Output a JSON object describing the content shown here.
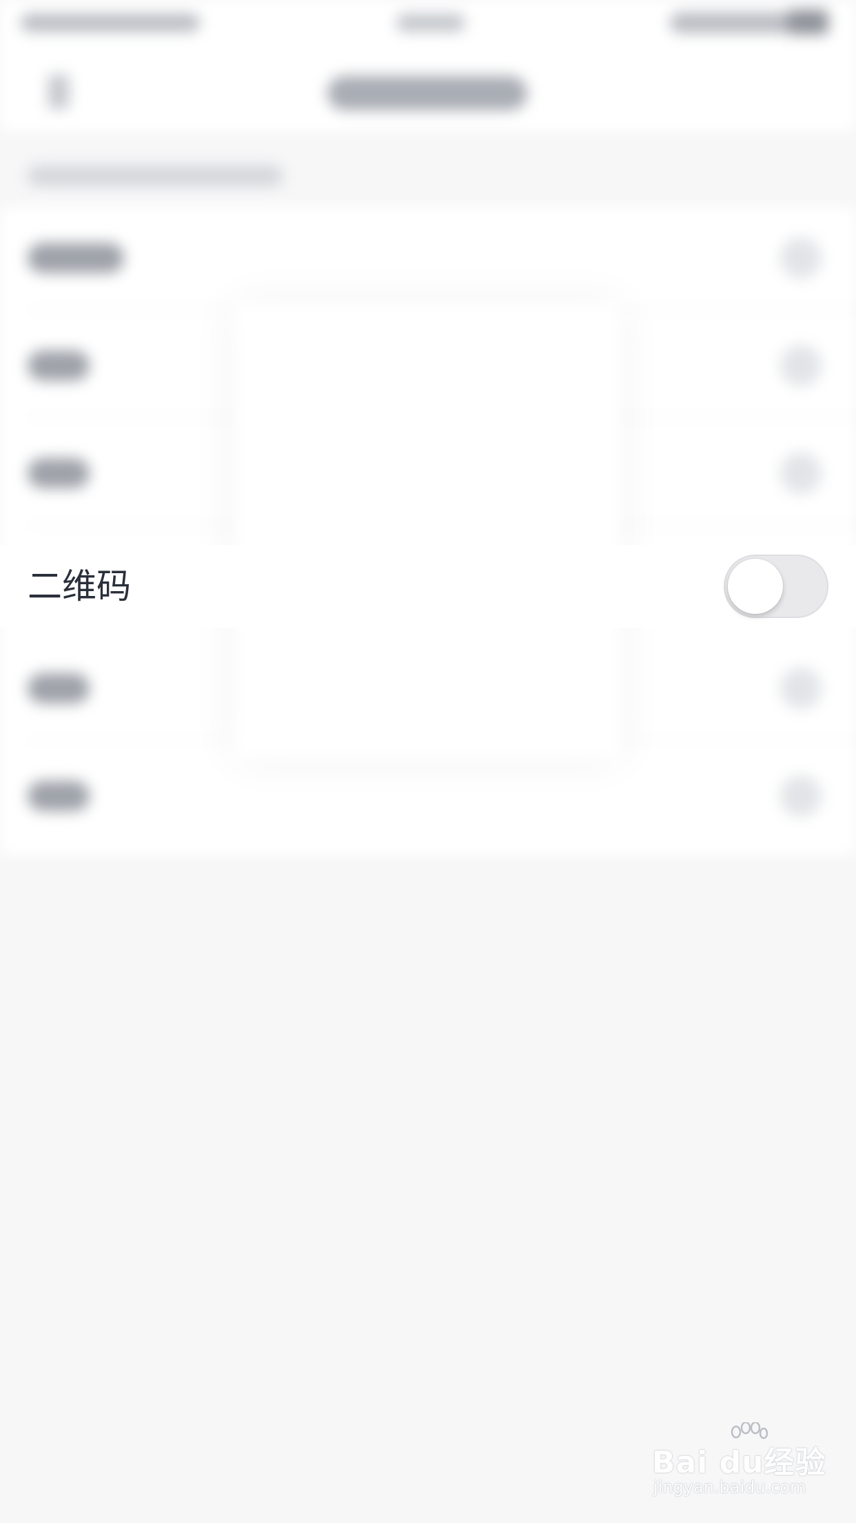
{
  "focused_row": {
    "label": "二维码",
    "toggle": {
      "state": "off"
    }
  },
  "watermark": {
    "brand": "Bai du经验",
    "url": "jingyan.baidu.com"
  },
  "colors": {
    "label_text": "#2a2f3a",
    "toggle_track_off": "#e9e9ec",
    "background": "#f7f7f8"
  }
}
